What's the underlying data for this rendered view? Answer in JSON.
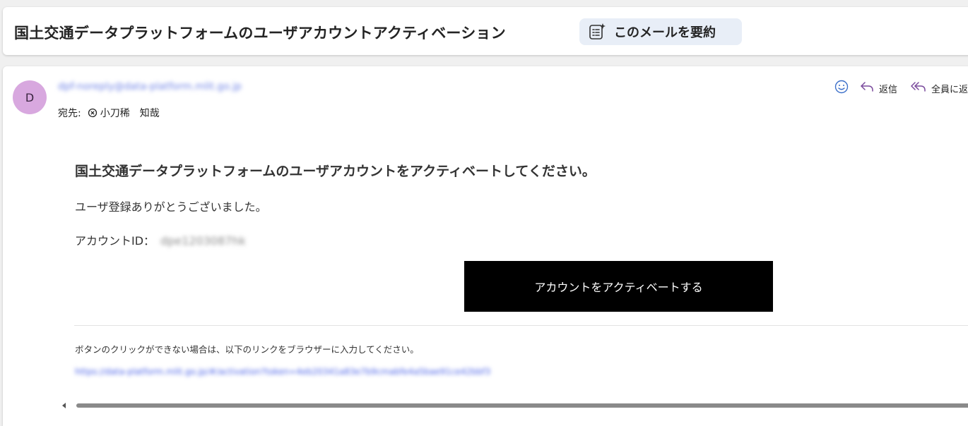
{
  "subject": {
    "title": "国土交通データプラットフォームのユーザアカウントアクティベーション",
    "summarize_label": "このメールを要約"
  },
  "message": {
    "avatar_initial": "D",
    "sender": "dpf-noreply@data-platform.mlit.go.jp",
    "to_label": "宛先:",
    "recipient": "小刀稀　知哉",
    "actions": {
      "reply_label": "返信",
      "reply_all_label": "全員に返信"
    }
  },
  "body": {
    "headline": "国土交通データプラットフォームのユーザアカウントをアクティベートしてください。",
    "thanks": "ユーザ登録ありがとうございました。",
    "account_id_label": "アカウントID：",
    "account_id_value": "dpe1203087hk",
    "activate_button": "アカウントをアクティベートする",
    "fallback_note": "ボタンのクリックができない場合は、以下のリンクをブラウザーに入力してください。",
    "fallback_link": "https://data-platform.mlit.go.jp/#/activation?token=4eb20341a83e7b9cmabfe4a5bae91ce42bbf3"
  },
  "colors": {
    "accent": "#4a62e8",
    "avatar": "#d8a8df",
    "summarize_bg": "#e8eef7",
    "button_bg": "#000000"
  }
}
